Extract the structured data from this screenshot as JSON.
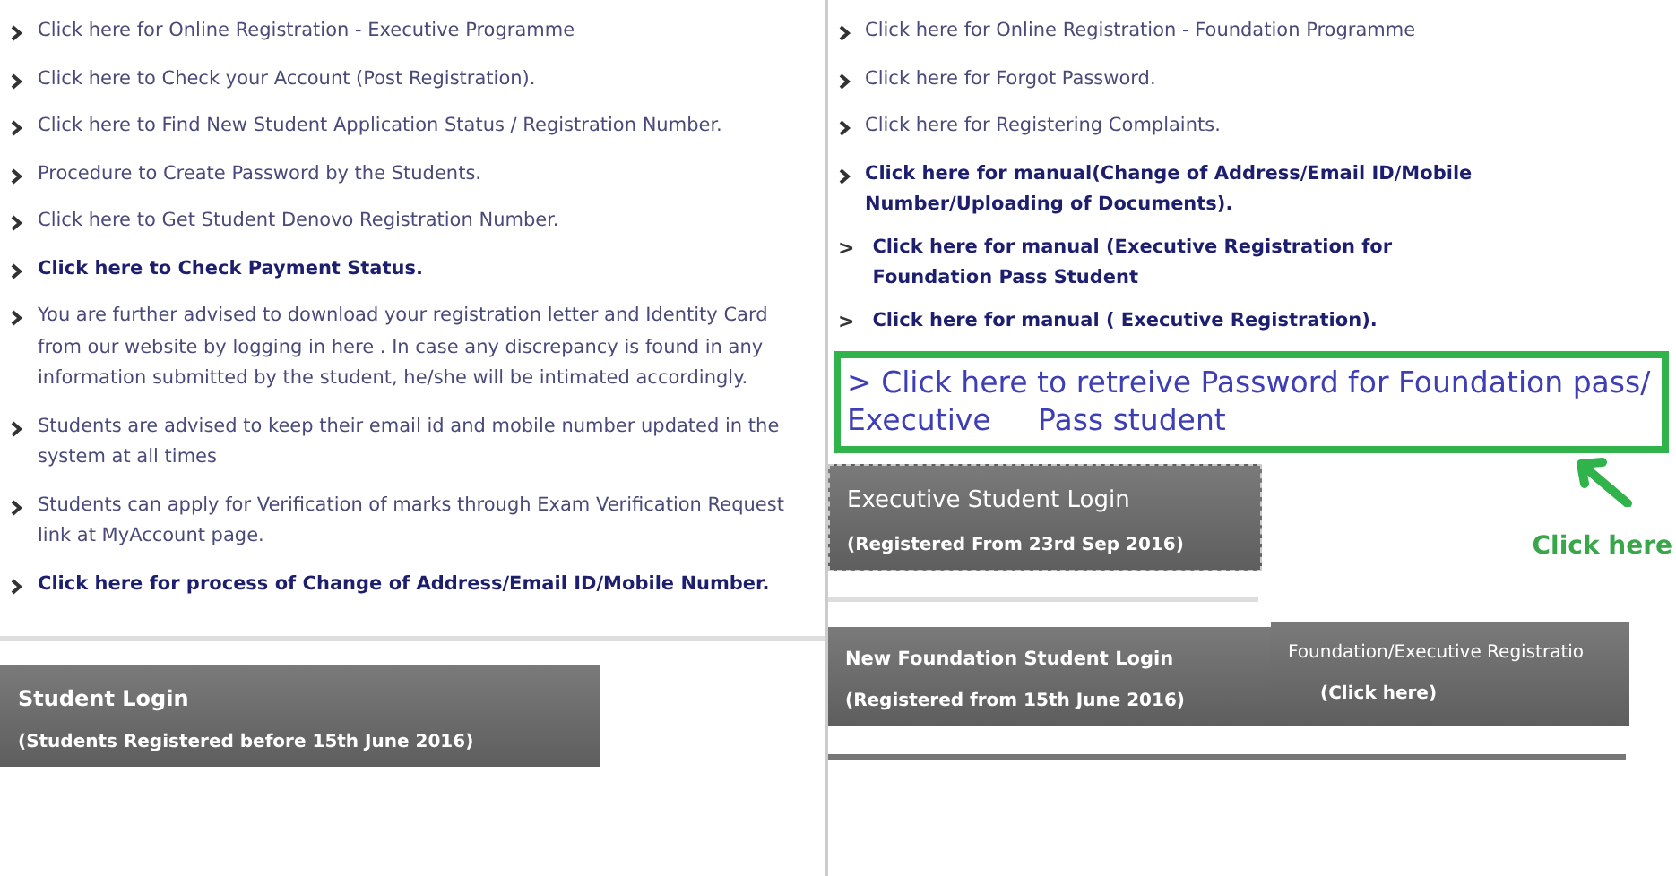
{
  "left_links": [
    {
      "kind": "bullet",
      "text": "Click here for Online Registration - Executive Programme",
      "bold": false
    },
    {
      "kind": "bullet",
      "text": "Click here to Check your Account (Post Registration).",
      "bold": false
    },
    {
      "kind": "bullet",
      "text": "Click here to Find New Student Application Status / Registration Number.",
      "bold": false
    },
    {
      "kind": "bullet",
      "text": "Procedure to Create Password by the Students.",
      "bold": false
    },
    {
      "kind": "bullet",
      "text": "Click here to Get Student Denovo Registration Number.",
      "bold": false
    },
    {
      "kind": "bullet",
      "text": "Click here to Check Payment Status.",
      "bold": true
    },
    {
      "kind": "bullet",
      "text": "You are further advised to download your registration letter and Identity Card from our website by logging in here . In case any discrepancy is found in any information submitted by the student, he/she will be intimated accordingly.",
      "bold": false
    },
    {
      "kind": "bullet",
      "text": "Students are advised to keep their email id and mobile number updated in the system at all times",
      "bold": false
    },
    {
      "kind": "bullet",
      "text": "Students can apply for Verification of marks through Exam Verification Request link at MyAccount page.",
      "bold": false
    },
    {
      "kind": "bullet",
      "text": "Click here for process of Change of Address/Email ID/Mobile Number.",
      "bold": true
    }
  ],
  "student_login": {
    "title": "Student Login",
    "subtitle": "(Students Registered before 15th June 2016)"
  },
  "right_links": [
    {
      "kind": "bullet",
      "text": "Click here for Online Registration - Foundation Programme",
      "bold": false
    },
    {
      "kind": "bullet",
      "text": "Click here for Forgot Password.",
      "bold": false
    },
    {
      "kind": "bullet",
      "text": "Click here for  Registering Complaints.",
      "bold": false
    },
    {
      "kind": "bullet",
      "text": "Click here for manual(Change of Address/Email ID/Mobile Number/Uploading of Documents).",
      "bold": true
    },
    {
      "kind": "caret",
      "marker": ">",
      "text": "Click here for manual (Executive Registration for Foundation Pass Student",
      "bold": true
    },
    {
      "kind": "caret",
      "marker": ">",
      "text": "Click here for manual ( Executive Registration).",
      "bold": true
    }
  ],
  "highlight_link": "> Click here to retreive Password for Foundation pass/ Executive     Pass student",
  "callout": "Click here",
  "executive_login": {
    "title": "Executive Student Login",
    "subtitle": "(Registered From 23rd Sep 2016)"
  },
  "foundation_login": {
    "title": "New Foundation Student Login",
    "subtitle": "(Registered from 15th June 2016)"
  },
  "registration": {
    "title": "Foundation/Executive Registratio",
    "subtitle": "(Click here)"
  }
}
